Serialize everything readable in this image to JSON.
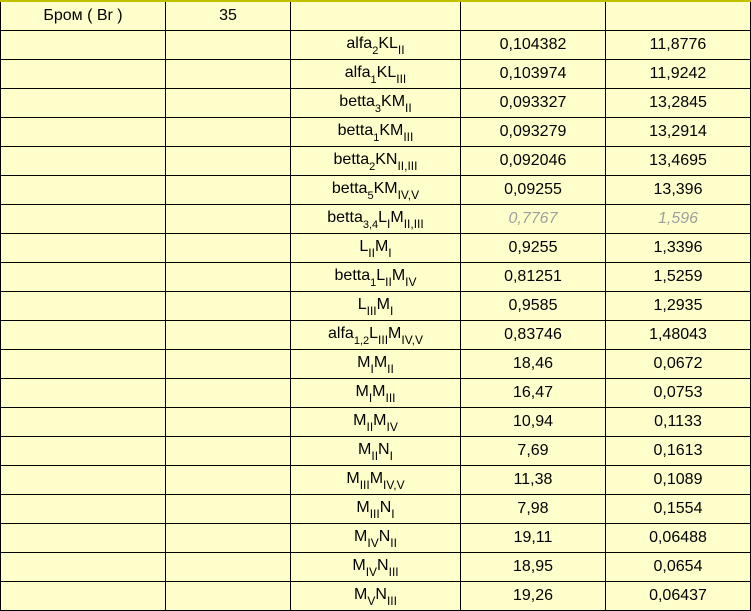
{
  "header": {
    "element": "Бром ( Br )",
    "atomic_number": "35"
  },
  "rows": [
    {
      "label_prefix": "alfa",
      "label_sub1": "2",
      "label_mid": "KL",
      "label_sub2": "II",
      "val1": "0,104382",
      "val2": "11,8776",
      "faded": false
    },
    {
      "label_prefix": "alfa",
      "label_sub1": "1",
      "label_mid": "KL",
      "label_sub2": "III",
      "val1": "0,103974",
      "val2": "11,9242",
      "faded": false
    },
    {
      "label_prefix": "betta",
      "label_sub1": "3",
      "label_mid": "KM",
      "label_sub2": "II",
      "val1": "0,093327",
      "val2": "13,2845",
      "faded": false
    },
    {
      "label_prefix": "betta",
      "label_sub1": "1",
      "label_mid": "KM",
      "label_sub2": "III",
      "val1": "0,093279",
      "val2": "13,2914",
      "faded": false
    },
    {
      "label_prefix": "betta",
      "label_sub1": "2",
      "label_mid": "KN",
      "label_sub2": "II,III",
      "val1": "0,092046",
      "val2": "13,4695",
      "faded": false
    },
    {
      "label_prefix": "betta",
      "label_sub1": "5",
      "label_mid": "KM",
      "label_sub2": "IV,V",
      "val1": "0,09255",
      "val2": "13,396",
      "faded": false
    },
    {
      "label_prefix": "betta",
      "label_sub1": "3,4",
      "label_mid_parts": [
        "L",
        "I",
        "M",
        "II,III"
      ],
      "val1": "0,7767",
      "val2": "1,596",
      "faded": true
    },
    {
      "label_mid_parts": [
        "L",
        "II",
        "M",
        "I"
      ],
      "val1": "0,9255",
      "val2": "1,3396",
      "faded": false
    },
    {
      "label_prefix": "betta",
      "label_sub1": "1",
      "label_mid_parts": [
        "L",
        "II",
        "M",
        "IV"
      ],
      "val1": "0,81251",
      "val2": "1,5259",
      "faded": false
    },
    {
      "label_mid_parts": [
        "L",
        "III",
        "M",
        "I"
      ],
      "val1": "0,9585",
      "val2": "1,2935",
      "faded": false
    },
    {
      "label_prefix": "alfa",
      "label_sub1": "1,2",
      "label_mid_parts": [
        "L",
        "III",
        "M",
        "IV,V"
      ],
      "val1": "0,83746",
      "val2": "1,48043",
      "faded": false
    },
    {
      "label_mid_parts": [
        "M",
        "I",
        "M",
        "II"
      ],
      "val1": "18,46",
      "val2": "0,0672",
      "faded": false
    },
    {
      "label_mid_parts": [
        "M",
        "I",
        "M",
        "III"
      ],
      "val1": "16,47",
      "val2": "0,0753",
      "faded": false
    },
    {
      "label_mid_parts": [
        "M",
        "II",
        "M",
        "IV"
      ],
      "val1": "10,94",
      "val2": "0,1133",
      "faded": false
    },
    {
      "label_mid_parts": [
        "M",
        "II",
        "N",
        "I"
      ],
      "val1": "7,69",
      "val2": "0,1613",
      "faded": false
    },
    {
      "label_mid_parts": [
        "M",
        "III",
        "M",
        "IV,V"
      ],
      "val1": "11,38",
      "val2": "0,1089",
      "faded": false
    },
    {
      "label_mid_parts": [
        "M",
        "III",
        "N",
        "I"
      ],
      "val1": "7,98",
      "val2": "0,1554",
      "faded": false
    },
    {
      "label_mid_parts": [
        "M",
        "IV",
        "N",
        "II"
      ],
      "val1": "19,11",
      "val2": "0,06488",
      "faded": false
    },
    {
      "label_mid_parts": [
        "M",
        "IV",
        "N",
        "III"
      ],
      "val1": "18,95",
      "val2": "0,0654",
      "faded": false
    },
    {
      "label_mid_parts": [
        "M",
        "V",
        "N",
        "III"
      ],
      "val1": "19,26",
      "val2": "0,06437",
      "faded": false
    }
  ]
}
